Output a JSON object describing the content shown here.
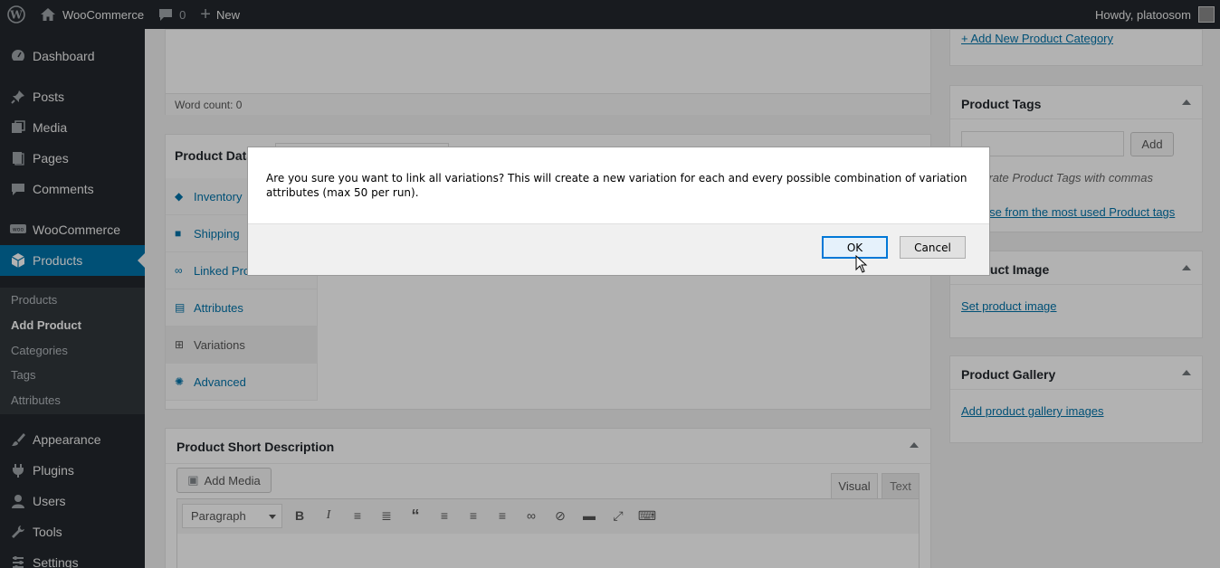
{
  "adminbar": {
    "site_name": "WooCommerce",
    "comments_count": "0",
    "new_label": "New",
    "greeting": "Howdy, platoosom"
  },
  "sidebar": {
    "items": [
      {
        "label": "Dashboard",
        "icon": "dashboard-icon"
      },
      {
        "label": "Posts",
        "icon": "pin-icon"
      },
      {
        "label": "Media",
        "icon": "media-icon"
      },
      {
        "label": "Pages",
        "icon": "pages-icon"
      },
      {
        "label": "Comments",
        "icon": "comment-icon"
      },
      {
        "label": "WooCommerce",
        "icon": "woo-icon"
      },
      {
        "label": "Products",
        "icon": "box-icon",
        "current": true
      },
      {
        "label": "Appearance",
        "icon": "brush-icon"
      },
      {
        "label": "Plugins",
        "icon": "plug-icon"
      },
      {
        "label": "Users",
        "icon": "user-icon"
      },
      {
        "label": "Tools",
        "icon": "wrench-icon"
      },
      {
        "label": "Settings",
        "icon": "settings-icon"
      }
    ],
    "submenu": [
      "Products",
      "Add Product",
      "Categories",
      "Tags",
      "Attributes"
    ],
    "submenu_current": "Add Product"
  },
  "editor": {
    "word_count": "Word count: 0"
  },
  "product_data": {
    "title": "Product Data",
    "tabs": [
      "Inventory",
      "Shipping",
      "Linked Products",
      "Attributes",
      "Variations",
      "Advanced"
    ],
    "active_tab": "Variations"
  },
  "short_description": {
    "title": "Product Short Description",
    "add_media": "Add Media",
    "tab_visual": "Visual",
    "tab_text": "Text",
    "format_select": "Paragraph"
  },
  "right_col": {
    "add_category_link": "+ Add New Product Category",
    "tags_title": "Product Tags",
    "tags_add_button": "Add",
    "tags_hint": "Separate Product Tags with commas",
    "tags_choose_link": "Choose from the most used Product tags",
    "image_title": "Product Image",
    "image_link": "Set product image",
    "gallery_title": "Product Gallery",
    "gallery_link": "Add product gallery images"
  },
  "dialog": {
    "message": "Are you sure you want to link all variations? This will create a new variation for each and every possible combination of variation attributes (max 50 per run).",
    "ok_label": "OK",
    "cancel_label": "Cancel"
  },
  "colors": {
    "admin_dark": "#23282d",
    "accent": "#0073aa",
    "link": "#0073aa"
  }
}
